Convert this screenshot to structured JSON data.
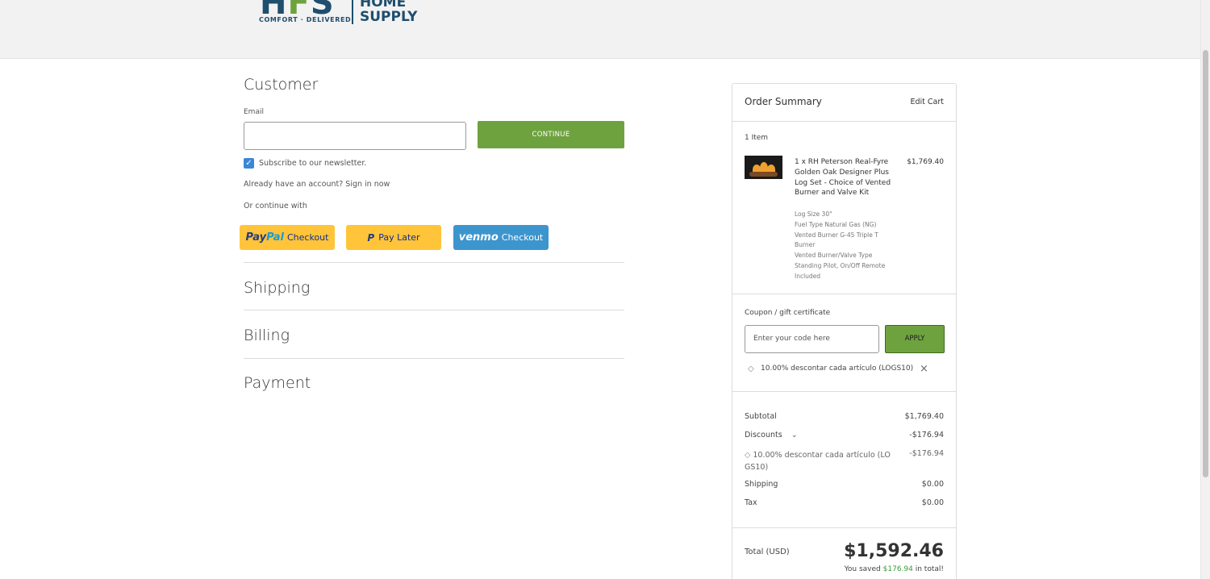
{
  "header": {
    "logo_letters_a": "H",
    "logo_letters_b": "F",
    "logo_letters_c": "S",
    "logo_tagline": "COMFORT · DELIVERED",
    "logo_line1": "HOME",
    "logo_line2": "SUPPLY",
    "colors": {
      "brand_blue": "#1f4e6e",
      "brand_green": "#6ea23f"
    }
  },
  "customer": {
    "title": "Customer",
    "email_label": "Email",
    "email_value": "",
    "continue_label": "CONTINUE",
    "subscribe_label": "Subscribe to our newsletter.",
    "subscribe_checked": true,
    "account_prompt": "Already have an account?",
    "sign_in_label": "Sign in now",
    "or_continue": "Or continue with",
    "paypal_brand_a": "Pay",
    "paypal_brand_b": "Pal",
    "paypal_label": "Checkout",
    "paylater_icon": "P",
    "paylater_label": "Pay Later",
    "venmo_brand": "venmo",
    "venmo_label": "Checkout"
  },
  "sections": {
    "shipping": "Shipping",
    "billing": "Billing",
    "payment": "Payment"
  },
  "summary": {
    "title": "Order Summary",
    "edit_cart": "Edit Cart",
    "item_count": "1 Item",
    "item": {
      "name": "1 x RH Peterson Real-Fyre Golden Oak Designer Plus Log Set - Choice of Vented Burner and Valve Kit",
      "price": "$1,769.40",
      "options": [
        "Log Size 30\"",
        "Fuel Type Natural Gas (NG)",
        "Vented Burner G-45 Triple T Burner",
        "Vented Burner/Valve Type Standing Pilot, On/Off Remote Included"
      ]
    },
    "coupon_label": "Coupon / gift certificate",
    "coupon_placeholder": "Enter your code here",
    "apply_label": "APPLY",
    "applied_coupon": "10.00% descontar cada artículo (LOGS10)",
    "subtotal_label": "Subtotal",
    "subtotal_value": "$1,769.40",
    "discounts_label": "Discounts",
    "discounts_value": "-$176.94",
    "discount_detail_label": "10.00% descontar cada artículo (LO GS10)",
    "discount_detail_value": "-$176.94",
    "shipping_label": "Shipping",
    "shipping_value": "$0.00",
    "tax_label": "Tax",
    "tax_value": "$0.00",
    "total_label": "Total (USD)",
    "total_value": "$1,592.46",
    "saved_prefix": "You saved",
    "saved_amount": "$176.94",
    "saved_suffix": "in total!"
  }
}
